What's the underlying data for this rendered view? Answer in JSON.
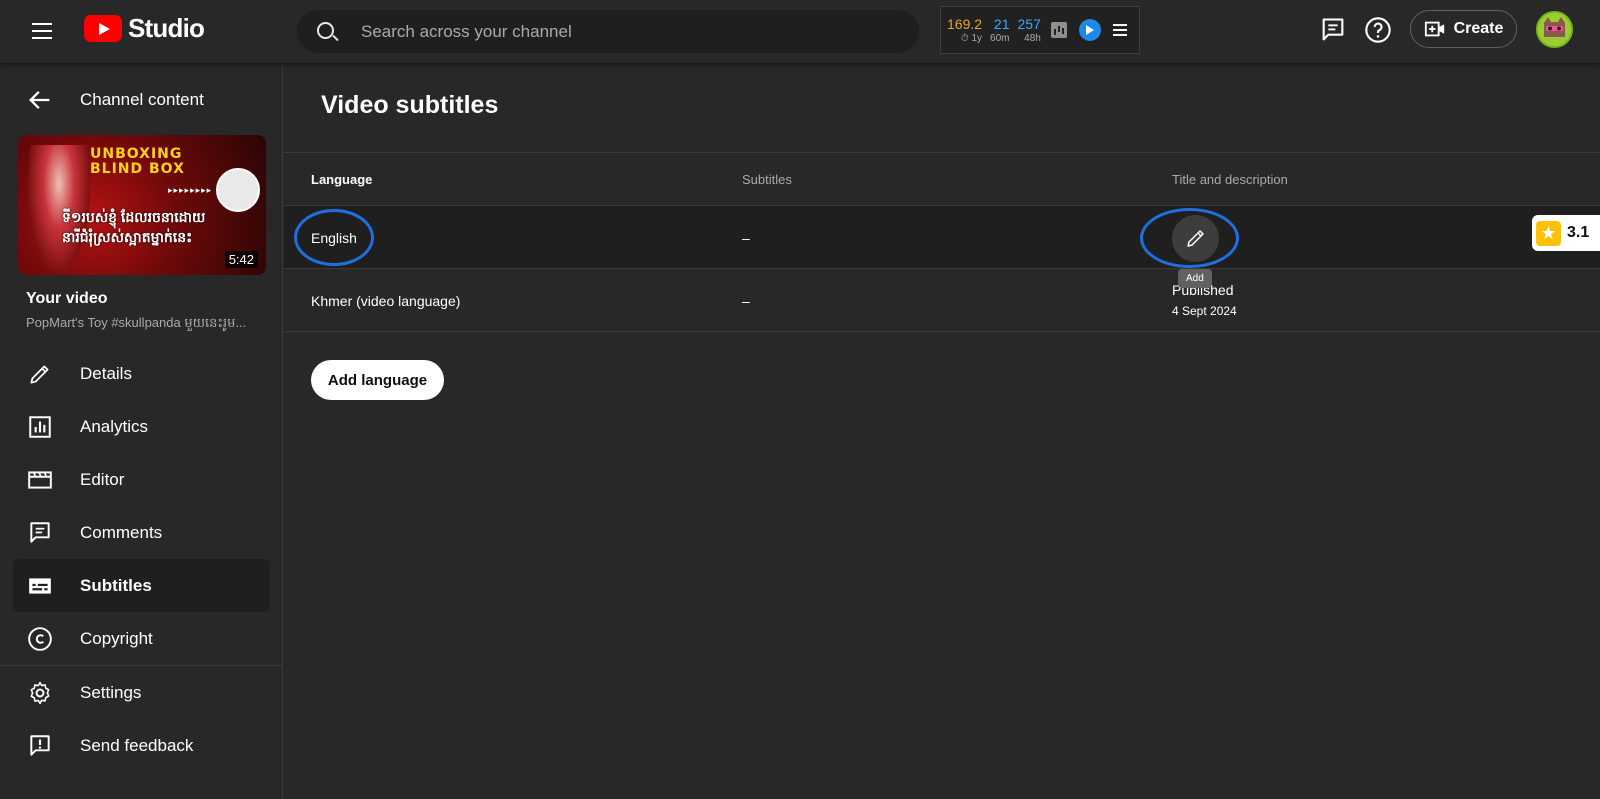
{
  "header": {
    "logo_text": "Studio",
    "search_placeholder": "Search across your channel",
    "stats": [
      {
        "value": "169.2",
        "label": "1y"
      },
      {
        "value": "21",
        "label": "60m"
      },
      {
        "value": "257",
        "label": "48h"
      }
    ],
    "create_label": "Create"
  },
  "sidebar": {
    "back_label": "Channel content",
    "thumbnail": {
      "line1": "UNBOXING",
      "line2": "BLIND BOX",
      "dots": "▸▸▸▸▸▸▸▸",
      "khmer_line1": "ទី១របស់ខ្ញុំ ដែលរចនាដោយ",
      "khmer_line2": "នារីជំរុំស្រស់ស្អាតម្នាក់នេះ",
      "duration": "5:42"
    },
    "your_video_label": "Your video",
    "video_title": "PopMart's Toy #skullpanda មួយនេះរូម...",
    "items": [
      {
        "label": "Details",
        "icon": "pencil-icon"
      },
      {
        "label": "Analytics",
        "icon": "analytics-icon"
      },
      {
        "label": "Editor",
        "icon": "editor-icon"
      },
      {
        "label": "Comments",
        "icon": "comments-icon"
      },
      {
        "label": "Subtitles",
        "icon": "subtitles-icon",
        "active": true
      },
      {
        "label": "Copyright",
        "icon": "copyright-icon"
      }
    ],
    "footer_items": [
      {
        "label": "Settings",
        "icon": "gear-icon"
      },
      {
        "label": "Send feedback",
        "icon": "feedback-icon"
      }
    ]
  },
  "main": {
    "title": "Video subtitles",
    "columns": [
      "Language",
      "Subtitles",
      "Title and description"
    ],
    "rows": [
      {
        "language": "English",
        "subtitles": "–",
        "tooltip": "Add"
      },
      {
        "language": "Khmer (video language)",
        "subtitles": "–",
        "status": "Published",
        "date": "4 Sept 2024"
      }
    ],
    "add_language_label": "Add language"
  },
  "rating": {
    "score": "3.1"
  },
  "colors": {
    "background": "#282828",
    "accent_blue": "#3ea6ff",
    "highlight": "#1e6fe0",
    "brand_red": "#ff0000"
  }
}
